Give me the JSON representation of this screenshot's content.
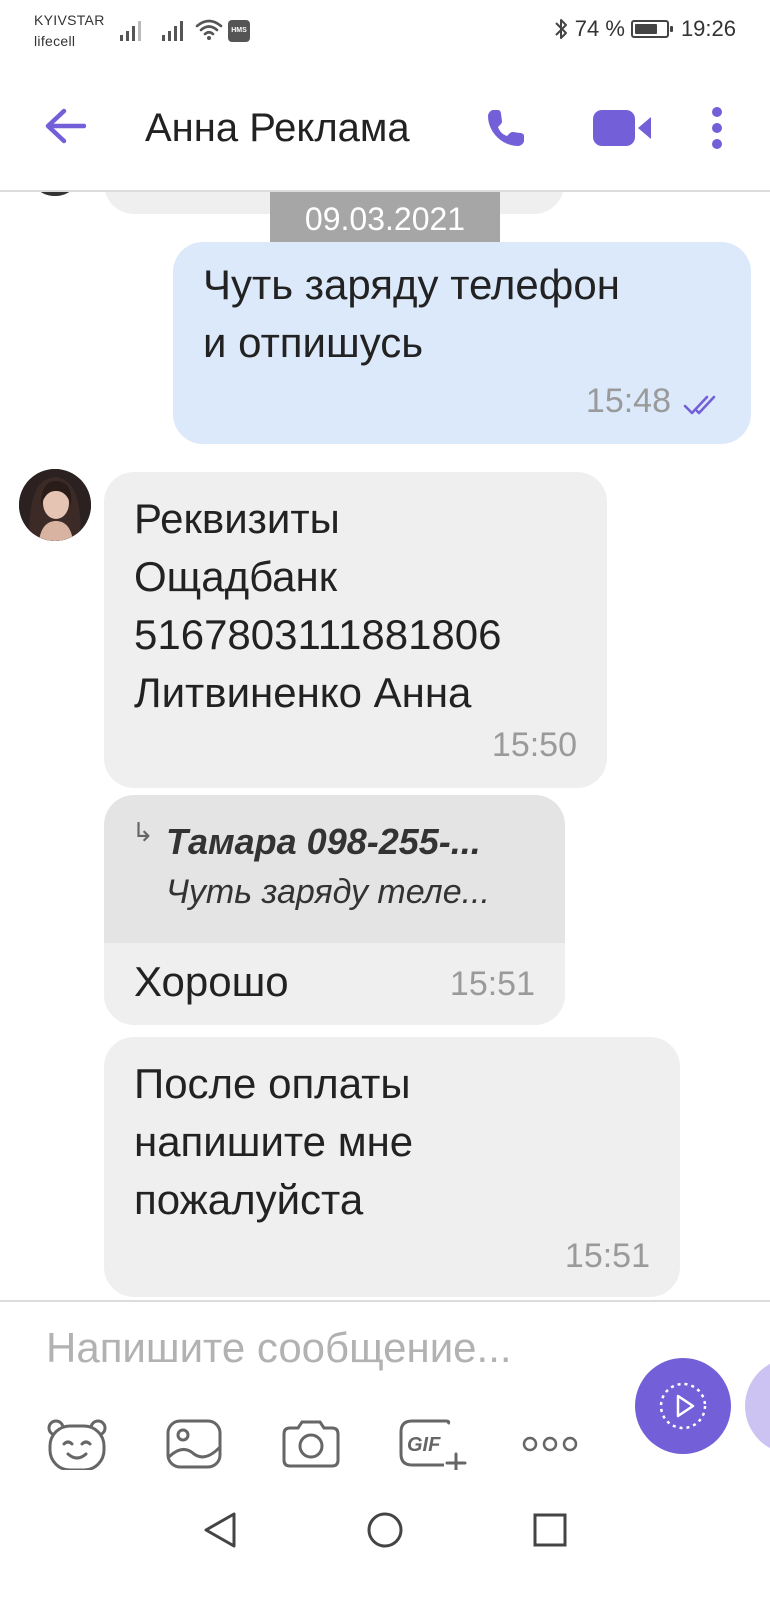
{
  "status_bar": {
    "carrier_1": "KYIVSTAR",
    "carrier_2": "lifecell",
    "hms_badge": "HMS",
    "battery": "74 %",
    "battery_level": 0.74,
    "time": "19:26"
  },
  "header": {
    "title": "Анна Реклама",
    "icons": [
      "back-arrow-icon",
      "phone-icon",
      "video-camera-icon",
      "more-vertical-icon"
    ]
  },
  "chat": {
    "date_separator": "09.03.2021",
    "messages": [
      {
        "direction": "outgoing",
        "lines": [
          "Чуть заряду телефон",
          "и отпишусь"
        ],
        "time": "15:48",
        "status": "read"
      },
      {
        "direction": "incoming",
        "lines": [
          "Реквизиты",
          "Ощадбанк",
          "5167803111881806",
          "Литвиненко Анна"
        ],
        "time": "15:50"
      },
      {
        "direction": "incoming",
        "reply_to": {
          "name": "Тамара 098-255-...",
          "snippet": "Чуть заряду теле..."
        },
        "lines": [
          "Хорошо"
        ],
        "time": "15:51"
      },
      {
        "direction": "incoming",
        "lines": [
          "После оплаты",
          "напишите мне",
          "пожалуйста"
        ],
        "time": "15:51"
      }
    ]
  },
  "composer": {
    "placeholder": "Напишите сообщение...",
    "tools": [
      "sticker-icon",
      "gallery-icon",
      "camera-icon",
      "gif-icon",
      "more-horizontal-icon"
    ],
    "accent_color": "#7360d8"
  },
  "nav": {
    "buttons": [
      "back-triangle-icon",
      "home-circle-icon",
      "recents-square-icon"
    ]
  },
  "colors": {
    "accent": "#7360d8",
    "outgoing_bubble": "#dbe9fb",
    "incoming_bubble": "#efefef"
  }
}
